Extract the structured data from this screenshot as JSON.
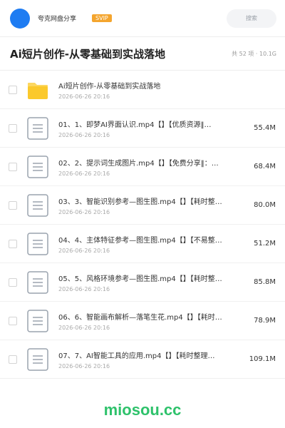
{
  "header": {
    "site_name": "夸克网盘分享",
    "vip_badge": "SVIP",
    "search_placeholder": "搜索",
    "avatar_color": "#1e7cf2",
    "badge_color": "#f4a52e"
  },
  "folder": {
    "title": "Ai短片创作-从零基础到实战落地",
    "meta": "共 52 项 · 10.1G"
  },
  "items": [
    {
      "type": "folder",
      "icon": "folder-icon",
      "name": "Ai短片创作-从零基础到实战落地",
      "date": "2026-06-26 20:16",
      "size": ""
    },
    {
      "type": "file",
      "icon": "document-icon",
      "name": "01、1、即梦AI界面认识.mp4【】【优质资源‖…",
      "date": "2026-06-26 20:16",
      "size": "55.4M"
    },
    {
      "type": "file",
      "icon": "document-icon",
      "name": "02、2、提示词生成图片.mp4【】【免费分享‖：…",
      "date": "2026-06-26 20:16",
      "size": "68.4M"
    },
    {
      "type": "file",
      "icon": "document-icon",
      "name": "03、3、智能识别参考—图生图.mp4【】【耗时整…",
      "date": "2026-06-26 20:16",
      "size": "80.0M"
    },
    {
      "type": "file",
      "icon": "document-icon",
      "name": "04、4、主体特征参考—图生图.mp4【】【不易整…",
      "date": "2026-06-26 20:16",
      "size": "51.2M"
    },
    {
      "type": "file",
      "icon": "document-icon",
      "name": "05、5、风格环境参考—图生图.mp4【】【耗时整…",
      "date": "2026-06-26 20:16",
      "size": "85.8M"
    },
    {
      "type": "file",
      "icon": "document-icon",
      "name": "06、6、智能画布解析—落笔生花.mp4【】【耗时…",
      "date": "2026-06-26 20:16",
      "size": "78.9M"
    },
    {
      "type": "file",
      "icon": "document-icon",
      "name": "07、7、AI智能工具的应用.mp4【】【耗时整理…",
      "date": "2026-06-26 20:16",
      "size": "109.1M"
    }
  ],
  "watermark": "miosou.cc",
  "colors": {
    "folder_yellow": "#fbc92c",
    "doc_icon_border": "#9aa3ae",
    "watermark_green": "#2ec26b"
  }
}
